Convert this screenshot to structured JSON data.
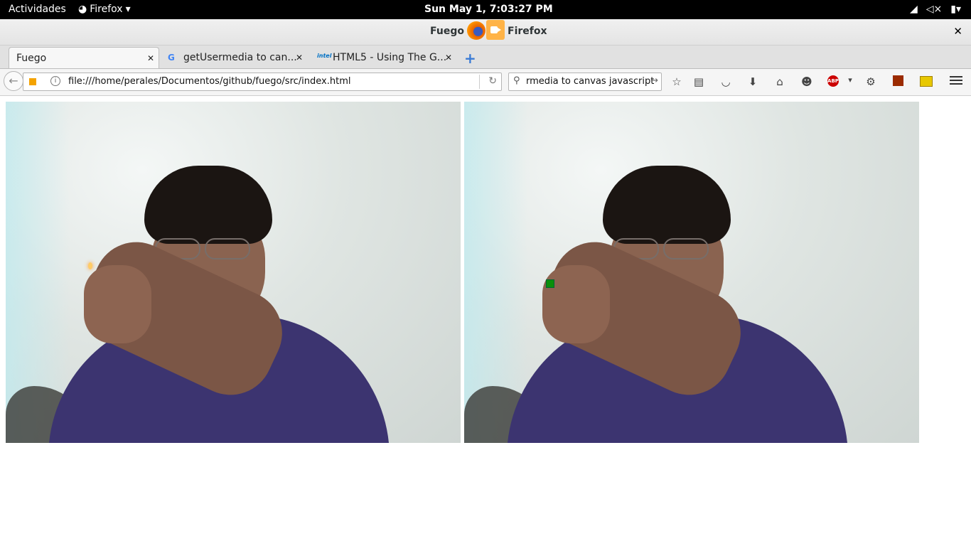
{
  "topbar": {
    "activities": "Actividades",
    "app_menu": "Firefox",
    "app_menu_arrow": "▾",
    "clock": "Sun May  1,  7:03:27 PM"
  },
  "window": {
    "title_part1": "Fuego –",
    "title_part2": "Firefox",
    "close": "✕"
  },
  "tabs": [
    {
      "label": "Fuego",
      "close": "✕"
    },
    {
      "label": "getUsermedia to can...",
      "favicon": "G",
      "close": "✕"
    },
    {
      "label": "HTML5 - Using The G...",
      "favicon": "intel",
      "close": "✕"
    }
  ],
  "new_tab": "+",
  "navbar": {
    "url": "file:///home/perales/Documentos/github/fuego/src/index.html",
    "search_value": "rmedia to canvas javascript",
    "search_go": "→",
    "reload": "↻",
    "back": "←",
    "info": "i"
  },
  "toolbar_icons": [
    "bookmark-star-icon",
    "reading-list-icon",
    "pocket-icon",
    "downloads-icon",
    "home-icon",
    "emoji-icon",
    "adblock-plus-icon",
    "dropdown-icon",
    "extension-icon",
    "square-extension-icon",
    "yellow-extension-icon",
    "menu-icon"
  ],
  "abp_label": "ABP",
  "colors": {
    "topbar_bg": "#000000",
    "marker": "#0a8f0a",
    "shirt": "#3c3470"
  }
}
